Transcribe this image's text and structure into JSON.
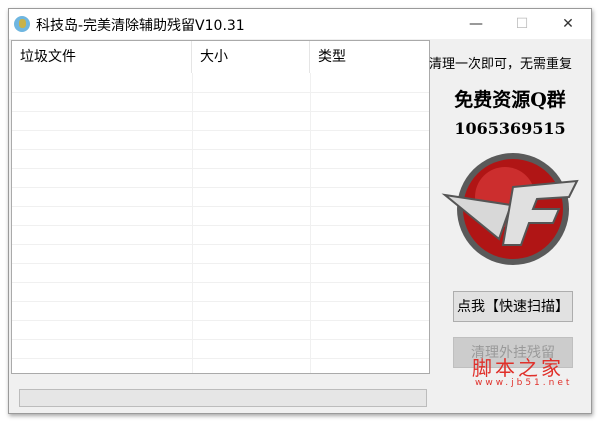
{
  "window": {
    "title": "科技岛-完美清除辅助残留V10.31",
    "minimize": "—",
    "maximize": "☐",
    "close": "✕"
  },
  "list": {
    "columns": [
      "垃圾文件",
      "大小",
      "类型"
    ],
    "rows": []
  },
  "progress": {
    "value": 0
  },
  "side": {
    "slogan": "清理一次即可，无需重复",
    "promo": "免费资源Q群",
    "qq_number": "1065369515",
    "logo_text": "CF"
  },
  "buttons": {
    "scan": "点我【快速扫描】",
    "clean": "清理外挂残留"
  },
  "watermark": {
    "name": "脚本之家",
    "url": "www.jb51.net"
  }
}
